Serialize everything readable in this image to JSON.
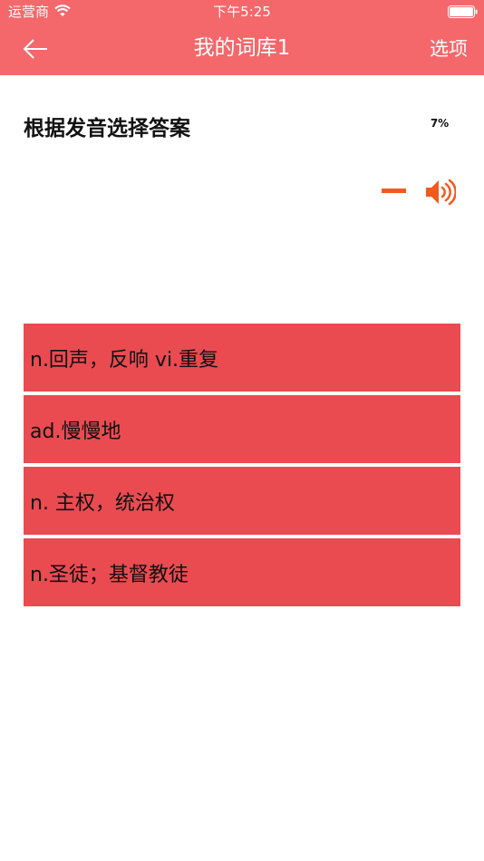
{
  "status_bar": {
    "carrier": "运营商",
    "time": "下午5:25"
  },
  "header": {
    "title": "我的词库1",
    "options_label": "选项"
  },
  "quiz": {
    "prompt": "根据发音选择答案",
    "progress": "7%",
    "options": [
      "n.回声，反响 vi.重复",
      "ad.慢慢地",
      "n. 主权，统治权",
      "n.圣徒；基督教徒"
    ]
  },
  "colors": {
    "header": "#f4676b",
    "option": "#e94b51",
    "speaker": "#f15a1e"
  }
}
